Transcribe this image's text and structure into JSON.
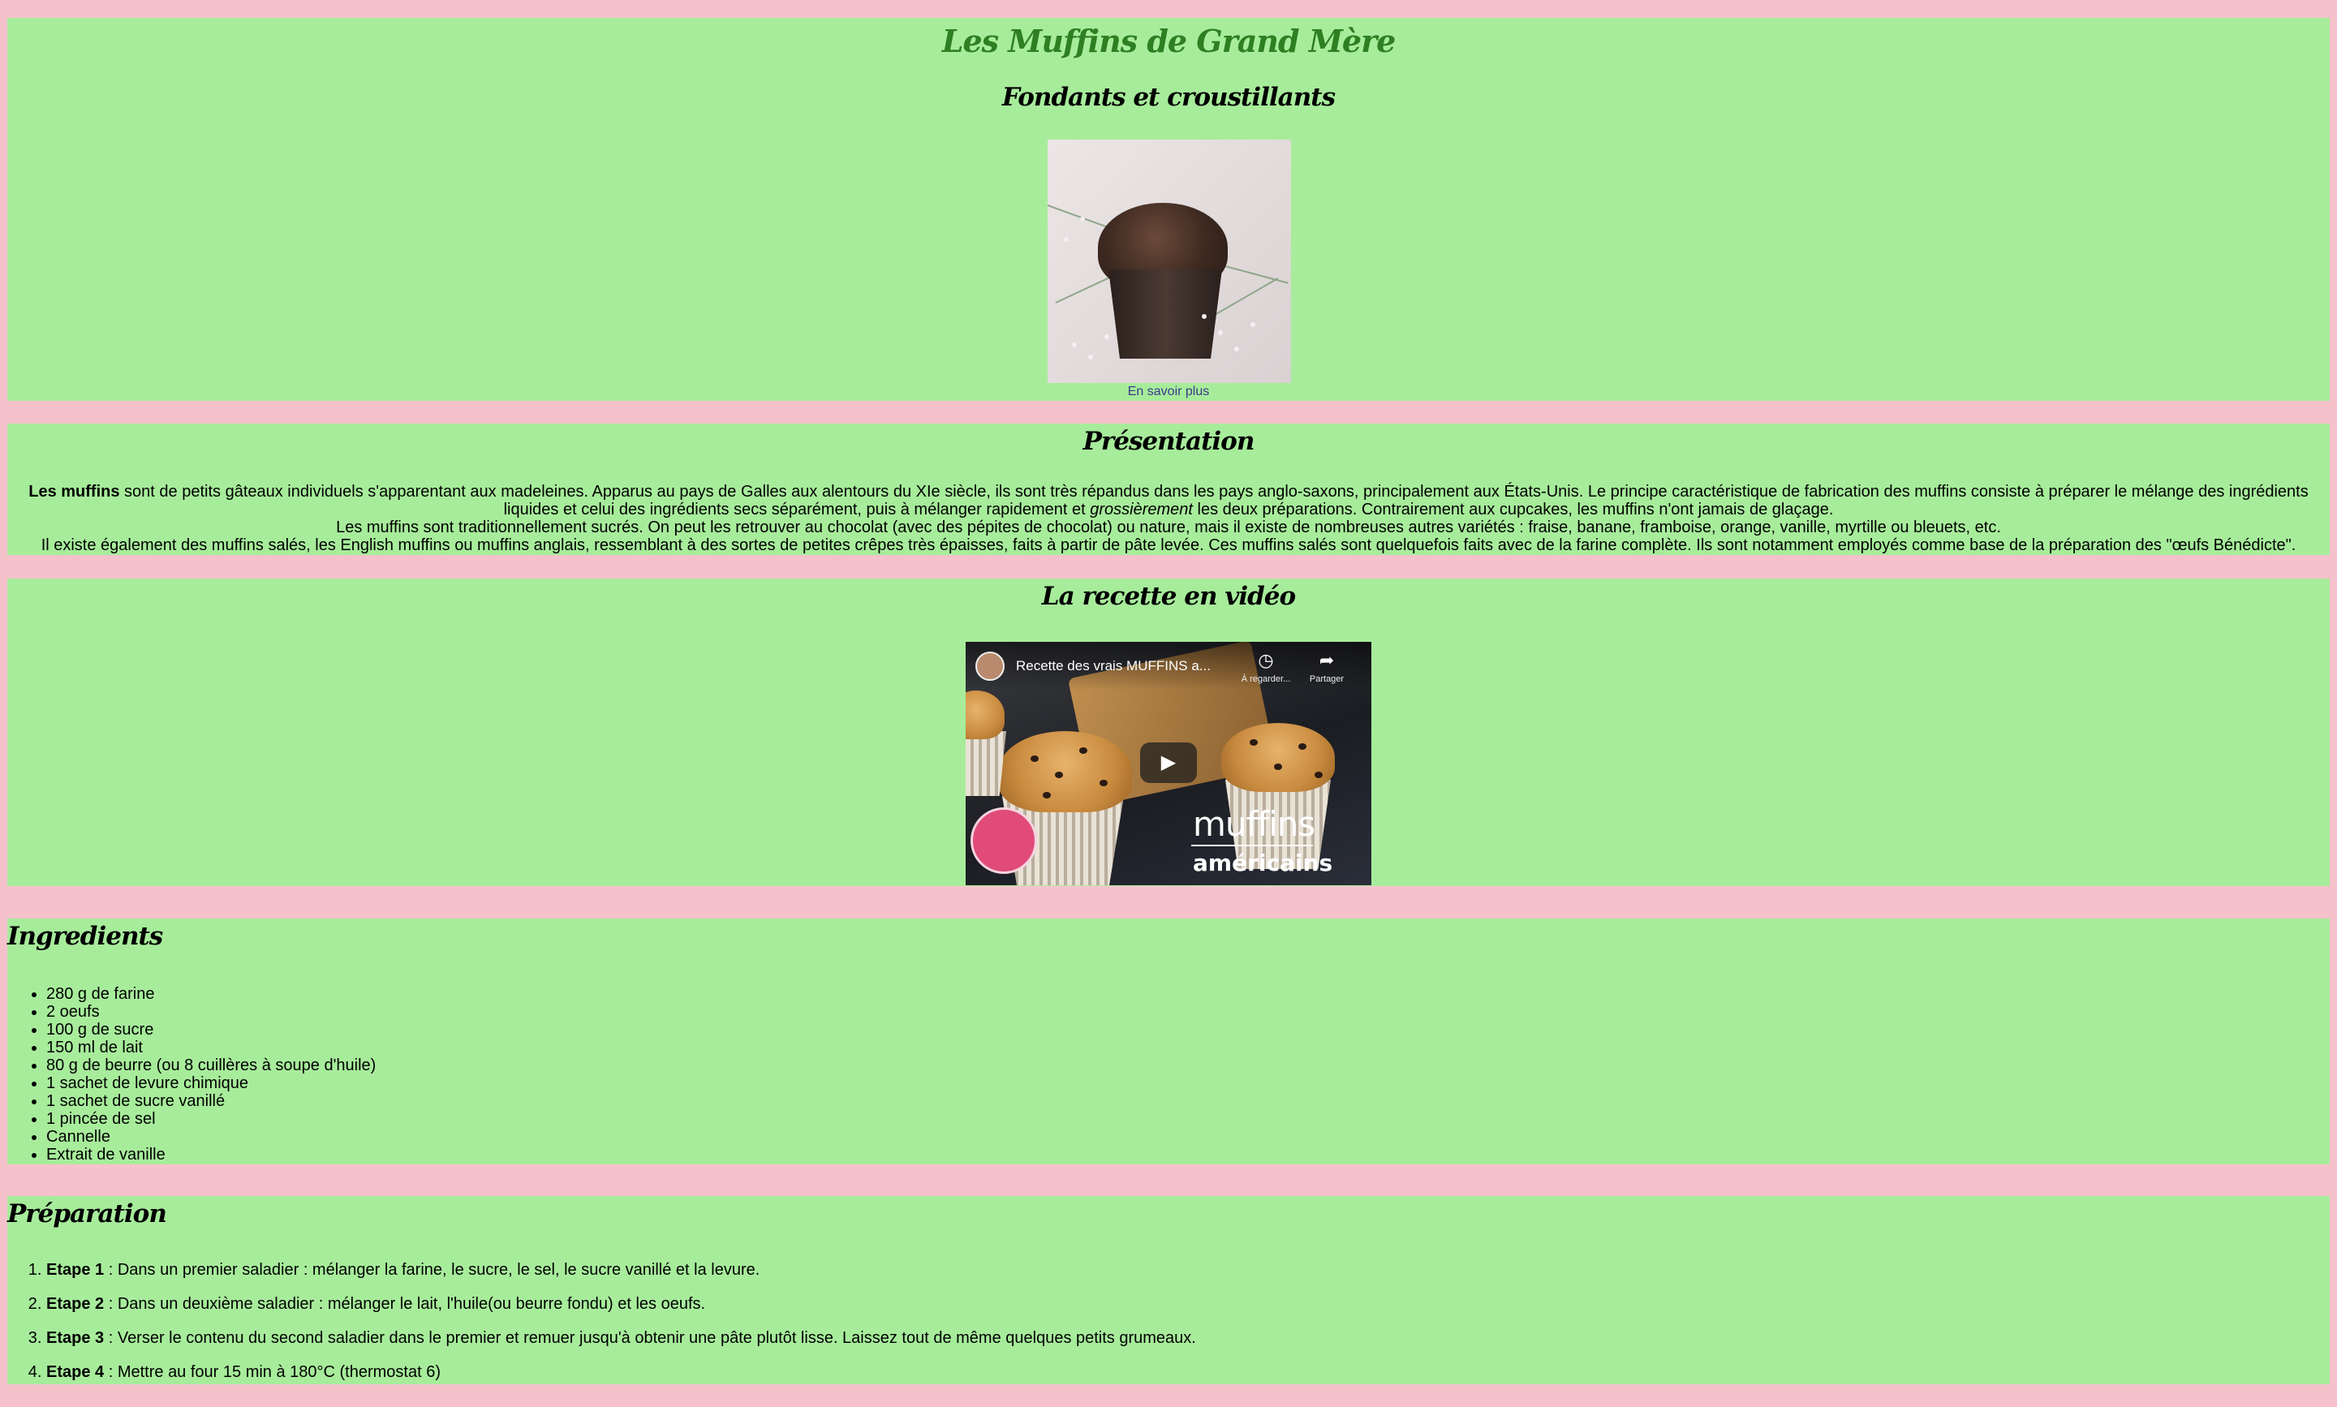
{
  "header": {
    "title": "Les Muffins de Grand Mère",
    "subtitle": "Fondants et croustillants",
    "image_alt": "muffin au chocolat",
    "more_link": "En savoir plus"
  },
  "presentation": {
    "heading": "Présentation",
    "lines": [
      {
        "strong": "Les muffins",
        "text": " sont de petits gâteaux individuels s'apparentant aux madeleines. Apparus au pays de Galles aux alentours du XIe siècle, ils sont très répandus dans les pays anglo-saxons, principalement aux États-Unis. Le principe caractéristique de fabrication des muffins consiste à préparer le mélange des ingrédients liquides et celui des ingrédients secs séparément, puis à mélanger rapidement et ",
        "em": "grossièrement",
        "after": " les deux préparations. Contrairement aux cupcakes, les muffins n'ont jamais de glaçage."
      },
      {
        "text": "Les muffins sont traditionnellement sucrés. On peut les retrouver au chocolat (avec des pépites de chocolat) ou nature, mais il existe de nombreuses autres variétés : fraise, banane, framboise, orange, vanille, myrtille ou bleuets, etc."
      },
      {
        "text": "Il existe également des muffins salés, les English muffins ou muffins anglais, ressemblant à des sortes de petites crêpes très épaisses, faits à partir de pâte levée. Ces muffins salés sont quelquefois faits avec de la farine complète. Ils sont notamment employés comme base de la préparation des \"œufs Bénédicte\"."
      }
    ]
  },
  "video": {
    "heading": "La recette en vidéo",
    "title": "Recette des vrais MUFFINS a...",
    "watch_later": "À regarder...",
    "share": "Partager",
    "brand_top": "muffins",
    "brand_bottom": "américains",
    "play_icon": "play-icon"
  },
  "ingredients": {
    "heading": "Ingredients",
    "items": [
      "280 g de farine",
      "2 oeufs",
      "100 g de sucre",
      "150 ml de lait",
      "80 g de beurre (ou 8 cuillères à soupe d'huile)",
      "1 sachet de levure chimique",
      "1 sachet de sucre vanillé",
      "1 pincée de sel",
      "Cannelle",
      "Extrait de vanille"
    ]
  },
  "preparation": {
    "heading": "Préparation",
    "steps": [
      {
        "label": "Etape 1",
        "text": " : Dans un premier saladier : mélanger la farine, le sucre, le sel, le sucre vanillé et la levure."
      },
      {
        "label": "Etape 2",
        "text": " : Dans un deuxième saladier : mélanger le lait, l'huile(ou beurre fondu) et les oeufs."
      },
      {
        "label": "Etape 3",
        "text": " : Verser le contenu du second saladier dans le premier et remuer jusqu'à obtenir une pâte plutôt lisse. Laissez tout de même quelques petits grumeaux."
      },
      {
        "label": "Etape 4",
        "text": " : Mettre au four 15 min à 180°C (thermostat 6)"
      }
    ]
  },
  "colors": {
    "background": "#f5c2cc",
    "section": "#a7ec9b",
    "title": "#2e7f22"
  }
}
